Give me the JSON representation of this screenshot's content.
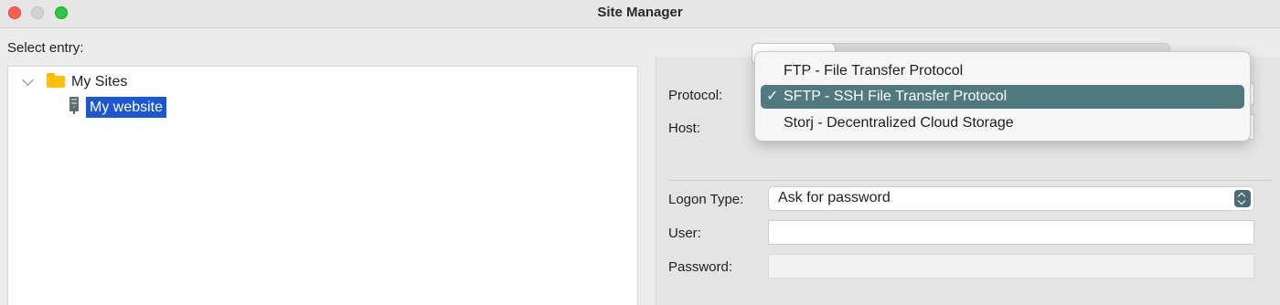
{
  "window": {
    "title": "Site Manager"
  },
  "left_pane": {
    "select_label": "Select entry:",
    "tree": {
      "folder_label": "My Sites",
      "site_label": "My website"
    }
  },
  "right_pane": {
    "labels": {
      "protocol": "Protocol:",
      "host": "Host:",
      "logon_type": "Logon Type:",
      "user": "User:",
      "password": "Password:"
    },
    "logon_type_value": "Ask for password",
    "user_value": "",
    "password_value": ""
  },
  "protocol_dropdown": {
    "options": [
      {
        "label": "FTP - File Transfer Protocol",
        "selected": false
      },
      {
        "label": "SFTP - SSH File Transfer Protocol",
        "selected": true
      },
      {
        "label": "Storj - Decentralized Cloud Storage",
        "selected": false
      }
    ],
    "check_mark": "✓"
  },
  "colors": {
    "selection_highlight": "#1c56d3",
    "dropdown_selected": "#507a80",
    "close": "#fe5f57",
    "maximize": "#28c840"
  }
}
